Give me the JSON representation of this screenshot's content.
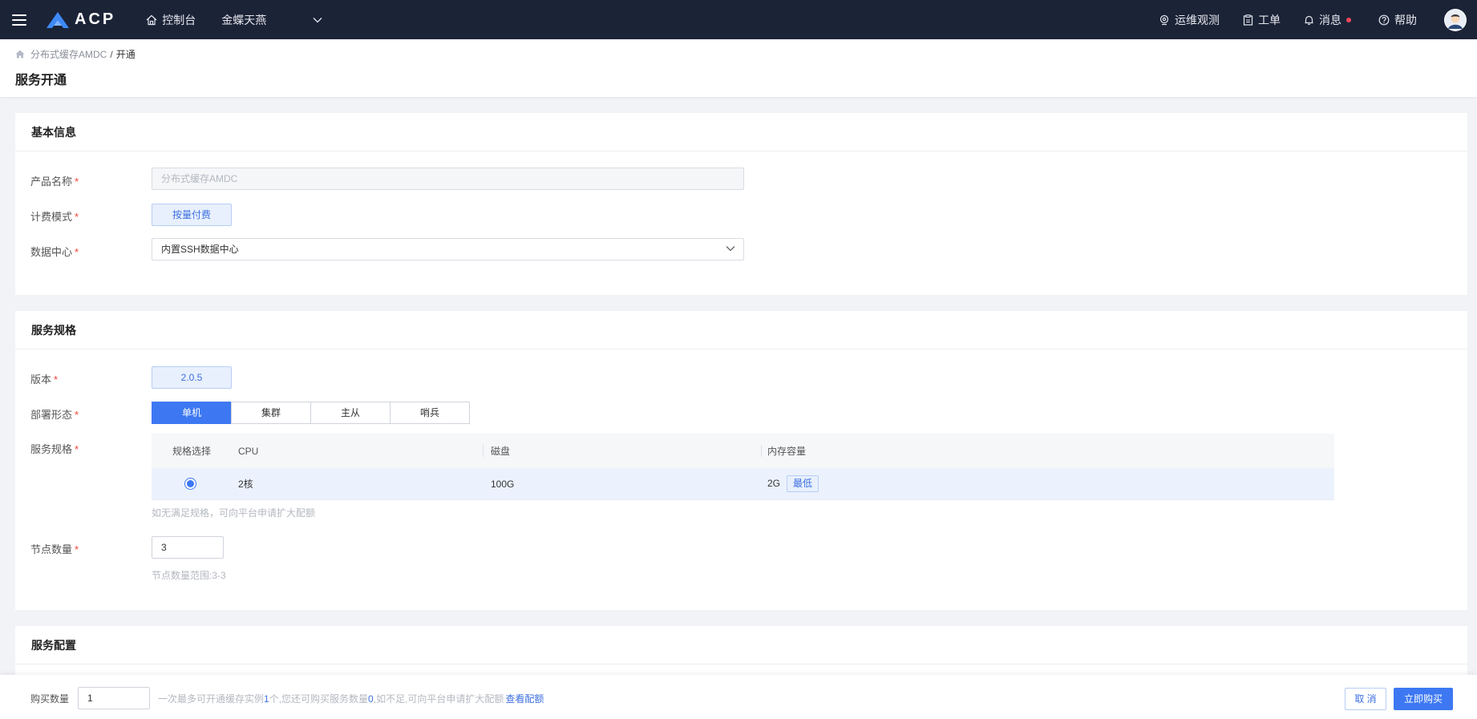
{
  "topbar": {
    "logo_text": "ACP",
    "console_label": "控制台",
    "tenant_label": "金蝶天燕",
    "ops_label": "运维观测",
    "ticket_label": "工单",
    "message_label": "消息",
    "help_label": "帮助"
  },
  "breadcrumb": {
    "parent": "分布式缓存AMDC",
    "separator": "/",
    "current": "开通"
  },
  "page": {
    "title": "服务开通"
  },
  "basic_info": {
    "title": "基本信息",
    "product_name_label": "产品名称",
    "product_name_placeholder": "分布式缓存AMDC",
    "billing_label": "计费模式",
    "billing_value": "按量付费",
    "datacenter_label": "数据中心",
    "datacenter_value": "内置SSH数据中心",
    "required_mark": "*"
  },
  "spec": {
    "title": "服务规格",
    "version_label": "版本",
    "version_value": "2.0.5",
    "deploy_label": "部署形态",
    "deploy_options": [
      "单机",
      "集群",
      "主从",
      "哨兵"
    ],
    "deploy_selected": "单机",
    "spec_label": "服务规格",
    "table_headers": [
      "规格选择",
      "CPU",
      "磁盘",
      "内存容量"
    ],
    "table_rows": [
      {
        "cpu": "2核",
        "disk": "100G",
        "memory": "2G",
        "badge": "最低",
        "selected": true
      }
    ],
    "spec_hint": "如无满足规格，可向平台申请扩大配额",
    "node_label": "节点数量",
    "node_value": "3",
    "node_hint": "节点数量范围:3-3"
  },
  "config": {
    "title": "服务配置"
  },
  "bottom": {
    "qty_label": "购买数量",
    "qty_value": "1",
    "hint_prefix": "一次最多可开通缓存实例",
    "hint_max": "1",
    "hint_mid": "个,您还可购买服务数量",
    "hint_remaining": "0",
    "hint_suffix": ",如不足,可向平台申请扩大配额",
    "hint_link": "查看配额",
    "cancel_label": "取 消",
    "buy_label": "立即购买"
  },
  "colors": {
    "navbar_bg": "#1b2337",
    "primary": "#3d78f2",
    "required": "#f04134",
    "notify_dot": "#f5455a"
  }
}
